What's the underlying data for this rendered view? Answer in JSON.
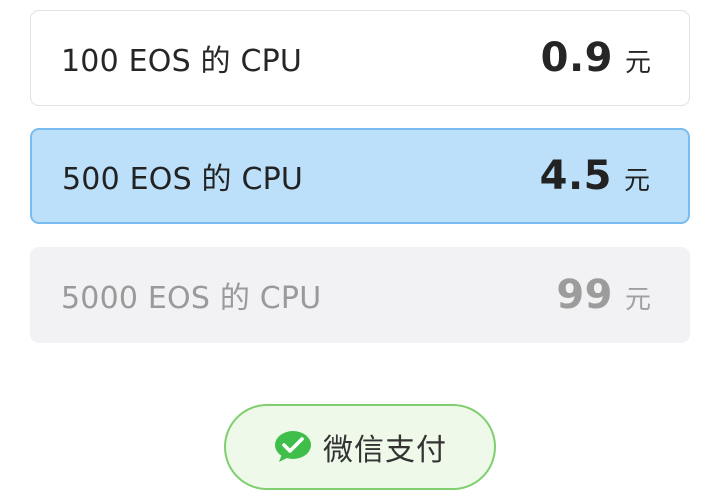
{
  "options": [
    {
      "label": "100 EOS 的 CPU",
      "amount": "0.9",
      "unit": "元",
      "state": "default"
    },
    {
      "label": "500 EOS 的 CPU",
      "amount": "4.5",
      "unit": "元",
      "state": "selected"
    },
    {
      "label": "5000 EOS 的 CPU",
      "amount": "99",
      "unit": "元",
      "state": "disabled"
    }
  ],
  "pay_button": {
    "label": "微信支付",
    "icon": "wechat-icon"
  },
  "colors": {
    "selected_fill": "#bcdffa",
    "selected_border": "#7bbcf0",
    "disabled_fill": "#f2f2f4",
    "pay_fill": "#eef9ea",
    "pay_border": "#7fcf6f",
    "wechat_green": "#3fbf4a"
  }
}
